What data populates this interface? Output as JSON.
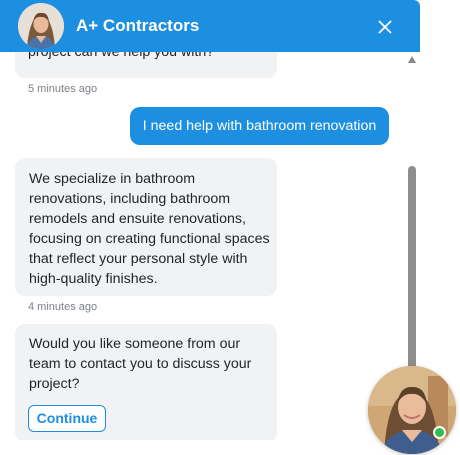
{
  "header": {
    "title": "A+ Contractors",
    "avatar_icon": "agent-avatar",
    "close_icon": "close-icon"
  },
  "messages": [
    {
      "from": "agent",
      "text_lines": [
        "project can we help you with?"
      ]
    },
    {
      "from": "timestamp",
      "text": "5 minutes ago"
    },
    {
      "from": "user",
      "text": "I need help with bathroom renovation"
    },
    {
      "from": "agent",
      "text_lines": [
        "We specialize in bathroom",
        "renovations, including bathroom",
        "remodels and ensuite renovations,",
        "focusing on creating functional spaces",
        "that reflect your personal style with",
        "high-quality finishes."
      ]
    },
    {
      "from": "timestamp",
      "text": "4 minutes ago"
    },
    {
      "from": "agent",
      "text_lines": [
        "Would you like someone from our",
        "team to contact you to discuss your",
        "project?"
      ],
      "button_label": "Continue"
    }
  ],
  "launcher": {
    "icon": "agent-avatar",
    "status": "online",
    "status_color": "#2fbf4f"
  },
  "colors": {
    "accent": "#1d8fe1",
    "bubble": "#f1f2f4",
    "timestamp": "#7c8187"
  }
}
